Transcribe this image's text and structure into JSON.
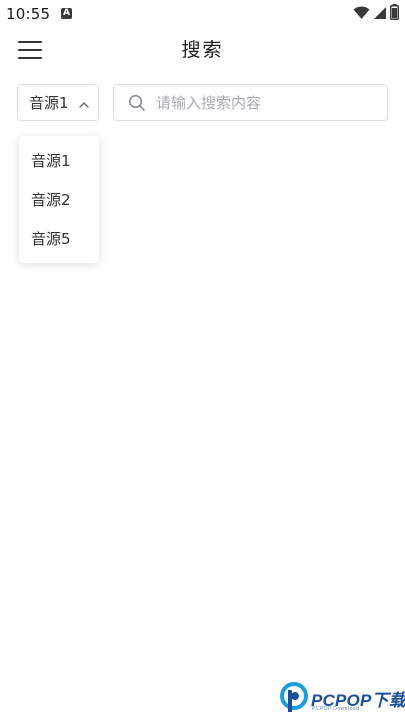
{
  "status_bar": {
    "time": "10:55",
    "notification_badge": "A",
    "icons": [
      "wifi-icon",
      "signal-icon",
      "battery-icon"
    ]
  },
  "header": {
    "title": "搜索",
    "menu_icon": "hamburger-menu-icon"
  },
  "source_select": {
    "value": "音源1",
    "expanded": true,
    "options": [
      "音源1",
      "音源2",
      "音源5"
    ]
  },
  "search": {
    "placeholder": "请输入搜索内容",
    "value": ""
  },
  "watermark": {
    "brand": "PCPOP下载",
    "tagline": "PCPOP.Download"
  },
  "colors": {
    "border": "#dcdfe6",
    "placeholder": "#a8abb2",
    "text": "#333333",
    "watermark_blue": "#1b4f9c"
  }
}
